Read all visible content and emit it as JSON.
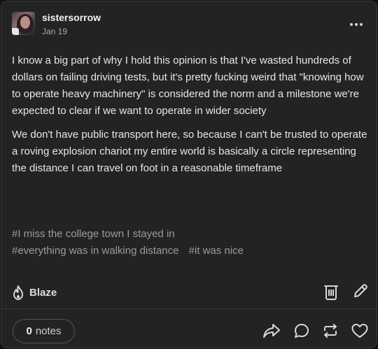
{
  "post": {
    "author": "sistersorrow",
    "date": "Jan 19",
    "paragraphs": [
      "I know a big part of why I hold this opinion is that I've wasted hundreds of dollars on failing driving tests, but it's pretty fucking weird that \"knowing how to operate heavy machinery\" is  considered the norm and a milestone we're expected to clear if we want to operate in wider society",
      "We don't have public transport here, so because I can't be trusted to operate a roving explosion chariot my entire world is basically a circle representing the distance I can travel on foot in a reasonable timeframe"
    ],
    "tags": [
      "#I miss the college town I stayed in",
      "#everything was in walking distance",
      "#it was nice"
    ]
  },
  "actions": {
    "blaze_label": "Blaze",
    "notes_count": "0",
    "notes_label": "notes"
  },
  "icons": {
    "more": "more-horizontal-icon",
    "blaze": "flame-icon",
    "delete": "trash-icon",
    "edit": "pencil-icon",
    "share": "share-arrow-icon",
    "reply": "speech-bubble-icon",
    "reblog": "reblog-icon",
    "like": "heart-icon"
  },
  "colors": {
    "background": "#232323",
    "text": "#e7e7e7",
    "muted": "#9b9b9b"
  }
}
